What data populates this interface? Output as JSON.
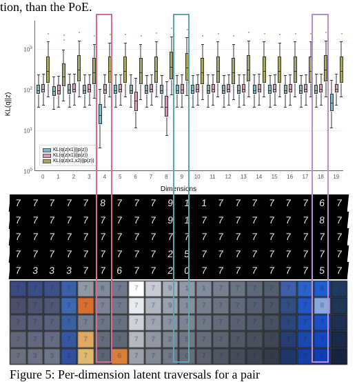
{
  "top_fragment": "tion, than the PoE.",
  "caption_fragment": "Figure 5: Per-dimension latent traversals for a pair",
  "highlights": [
    {
      "dim": 4,
      "color": "#d36e8a"
    },
    {
      "dim": 9,
      "color": "#5aa6b3"
    },
    {
      "dim": 18,
      "color": "#b48fd6"
    }
  ],
  "chart_data": {
    "type": "box",
    "title": "",
    "xlabel": "Dimensions",
    "ylabel": "KL(q||z)",
    "yscale": "log",
    "ylim": [
      1,
      5000
    ],
    "yticks": [
      1,
      10,
      100,
      1000
    ],
    "categories": [
      0,
      1,
      2,
      3,
      4,
      5,
      6,
      7,
      8,
      9,
      10,
      11,
      12,
      13,
      14,
      15,
      16,
      17,
      18,
      19
    ],
    "series": [
      {
        "name": "KL(q(z|x1)||p(z))",
        "color": "#7eb6c4"
      },
      {
        "name": "KL(q(z|x1)||p(z))",
        "color": "#d89ab4"
      },
      {
        "name": "KL(q(z|x1,x2)||p(z))",
        "color": "#a9a75a"
      }
    ],
    "data": {
      "0": {
        "s0": {
          "q1": 80,
          "med": 100,
          "q3": 130,
          "lo": 40,
          "hi": 250,
          "out": []
        },
        "s1": {
          "q1": 85,
          "med": 110,
          "q3": 140,
          "lo": 45,
          "hi": 260,
          "out": []
        },
        "s2": {
          "q1": 150,
          "med": 300,
          "q3": 650,
          "lo": 70,
          "hi": 1600,
          "out": [
            2400
          ]
        }
      },
      "1": {
        "s0": {
          "q1": 70,
          "med": 95,
          "q3": 120,
          "lo": 35,
          "hi": 220,
          "out": []
        },
        "s1": {
          "q1": 75,
          "med": 100,
          "q3": 130,
          "lo": 40,
          "hi": 230,
          "out": []
        },
        "s2": {
          "q1": 120,
          "med": 220,
          "q3": 450,
          "lo": 55,
          "hi": 1000,
          "out": [
            1700,
            2200
          ]
        }
      },
      "2": {
        "s0": {
          "q1": 80,
          "med": 105,
          "q3": 135,
          "lo": 40,
          "hi": 260,
          "out": []
        },
        "s1": {
          "q1": 85,
          "med": 110,
          "q3": 145,
          "lo": 45,
          "hi": 260,
          "out": []
        },
        "s2": {
          "q1": 160,
          "med": 320,
          "q3": 700,
          "lo": 70,
          "hi": 1700,
          "out": [
            2600
          ]
        }
      },
      "3": {
        "s0": {
          "q1": 80,
          "med": 100,
          "q3": 130,
          "lo": 40,
          "hi": 250,
          "out": []
        },
        "s1": {
          "q1": 85,
          "med": 110,
          "q3": 140,
          "lo": 45,
          "hi": 250,
          "out": []
        },
        "s2": {
          "q1": 140,
          "med": 280,
          "q3": 600,
          "lo": 65,
          "hi": 1400,
          "out": [
            2100
          ]
        }
      },
      "4": {
        "s0": {
          "q1": 14,
          "med": 25,
          "q3": 45,
          "lo": 4,
          "hi": 110,
          "out": []
        },
        "s1": {
          "q1": 80,
          "med": 105,
          "q3": 135,
          "lo": 40,
          "hi": 250,
          "out": []
        },
        "s2": {
          "q1": 150,
          "med": 300,
          "q3": 650,
          "lo": 70,
          "hi": 1500,
          "out": [
            2300
          ]
        }
      },
      "5": {
        "s0": {
          "q1": 80,
          "med": 100,
          "q3": 130,
          "lo": 40,
          "hi": 250,
          "out": []
        },
        "s1": {
          "q1": 85,
          "med": 110,
          "q3": 140,
          "lo": 45,
          "hi": 250,
          "out": []
        },
        "s2": {
          "q1": 150,
          "med": 300,
          "q3": 650,
          "lo": 70,
          "hi": 1500,
          "out": [
            2300
          ]
        }
      },
      "6": {
        "s0": {
          "q1": 80,
          "med": 100,
          "q3": 130,
          "lo": 40,
          "hi": 250,
          "out": []
        },
        "s1": {
          "q1": 30,
          "med": 55,
          "q3": 90,
          "lo": 12,
          "hi": 200,
          "out": []
        },
        "s2": {
          "q1": 140,
          "med": 280,
          "q3": 600,
          "lo": 60,
          "hi": 1400,
          "out": [
            2100
          ]
        }
      },
      "7": {
        "s0": {
          "q1": 80,
          "med": 100,
          "q3": 130,
          "lo": 40,
          "hi": 240,
          "out": []
        },
        "s1": {
          "q1": 85,
          "med": 110,
          "q3": 140,
          "lo": 45,
          "hi": 250,
          "out": []
        },
        "s2": {
          "q1": 150,
          "med": 300,
          "q3": 650,
          "lo": 70,
          "hi": 1600,
          "out": [
            2500
          ]
        }
      },
      "8": {
        "s0": {
          "q1": 80,
          "med": 100,
          "q3": 130,
          "lo": 40,
          "hi": 240,
          "out": []
        },
        "s1": {
          "q1": 22,
          "med": 40,
          "q3": 70,
          "lo": 8,
          "hi": 170,
          "out": []
        },
        "s2": {
          "q1": 180,
          "med": 380,
          "q3": 850,
          "lo": 80,
          "hi": 2100,
          "out": [
            3200
          ]
        }
      },
      "9": {
        "s0": {
          "q1": 80,
          "med": 100,
          "q3": 130,
          "lo": 40,
          "hi": 240,
          "out": []
        },
        "s1": {
          "q1": 80,
          "med": 105,
          "q3": 135,
          "lo": 40,
          "hi": 250,
          "out": []
        },
        "s2": {
          "q1": 170,
          "med": 360,
          "q3": 800,
          "lo": 75,
          "hi": 2000,
          "out": [
            3000
          ]
        }
      },
      "10": {
        "s0": {
          "q1": 80,
          "med": 100,
          "q3": 130,
          "lo": 40,
          "hi": 240,
          "out": []
        },
        "s1": {
          "q1": 85,
          "med": 110,
          "q3": 140,
          "lo": 45,
          "hi": 250,
          "out": []
        },
        "s2": {
          "q1": 140,
          "med": 280,
          "q3": 600,
          "lo": 60,
          "hi": 1400,
          "out": [
            2100
          ]
        }
      },
      "11": {
        "s0": {
          "q1": 80,
          "med": 100,
          "q3": 130,
          "lo": 40,
          "hi": 250,
          "out": []
        },
        "s1": {
          "q1": 85,
          "med": 110,
          "q3": 140,
          "lo": 45,
          "hi": 250,
          "out": []
        },
        "s2": {
          "q1": 150,
          "med": 300,
          "q3": 650,
          "lo": 70,
          "hi": 1600,
          "out": [
            2400
          ]
        }
      },
      "12": {
        "s0": {
          "q1": 80,
          "med": 100,
          "q3": 130,
          "lo": 40,
          "hi": 240,
          "out": []
        },
        "s1": {
          "q1": 85,
          "med": 110,
          "q3": 140,
          "lo": 45,
          "hi": 250,
          "out": []
        },
        "s2": {
          "q1": 140,
          "med": 280,
          "q3": 600,
          "lo": 60,
          "hi": 1400,
          "out": [
            2100
          ]
        }
      },
      "13": {
        "s0": {
          "q1": 80,
          "med": 100,
          "q3": 130,
          "lo": 40,
          "hi": 250,
          "out": []
        },
        "s1": {
          "q1": 85,
          "med": 110,
          "q3": 140,
          "lo": 45,
          "hi": 250,
          "out": []
        },
        "s2": {
          "q1": 160,
          "med": 320,
          "q3": 700,
          "lo": 70,
          "hi": 1700,
          "out": [
            2600
          ]
        }
      },
      "14": {
        "s0": {
          "q1": 80,
          "med": 100,
          "q3": 130,
          "lo": 40,
          "hi": 250,
          "out": []
        },
        "s1": {
          "q1": 85,
          "med": 110,
          "q3": 140,
          "lo": 45,
          "hi": 260,
          "out": []
        },
        "s2": {
          "q1": 150,
          "med": 300,
          "q3": 650,
          "lo": 70,
          "hi": 1600,
          "out": [
            2400
          ]
        }
      },
      "15": {
        "s0": {
          "q1": 80,
          "med": 100,
          "q3": 130,
          "lo": 40,
          "hi": 240,
          "out": []
        },
        "s1": {
          "q1": 85,
          "med": 110,
          "q3": 140,
          "lo": 45,
          "hi": 250,
          "out": []
        },
        "s2": {
          "q1": 150,
          "med": 300,
          "q3": 650,
          "lo": 70,
          "hi": 1500,
          "out": [
            2300
          ]
        }
      },
      "16": {
        "s0": {
          "q1": 80,
          "med": 100,
          "q3": 130,
          "lo": 40,
          "hi": 240,
          "out": []
        },
        "s1": {
          "q1": 85,
          "med": 110,
          "q3": 140,
          "lo": 45,
          "hi": 250,
          "out": []
        },
        "s2": {
          "q1": 150,
          "med": 300,
          "q3": 650,
          "lo": 70,
          "hi": 1600,
          "out": [
            2400
          ]
        }
      },
      "17": {
        "s0": {
          "q1": 80,
          "med": 100,
          "q3": 130,
          "lo": 40,
          "hi": 240,
          "out": []
        },
        "s1": {
          "q1": 85,
          "med": 110,
          "q3": 140,
          "lo": 45,
          "hi": 250,
          "out": []
        },
        "s2": {
          "q1": 150,
          "med": 300,
          "q3": 650,
          "lo": 70,
          "hi": 1600,
          "out": [
            2400
          ]
        }
      },
      "18": {
        "s0": {
          "q1": 80,
          "med": 100,
          "q3": 130,
          "lo": 40,
          "hi": 260,
          "out": []
        },
        "s1": {
          "q1": 85,
          "med": 110,
          "q3": 140,
          "lo": 45,
          "hi": 260,
          "out": []
        },
        "s2": {
          "q1": 160,
          "med": 320,
          "q3": 700,
          "lo": 70,
          "hi": 1700,
          "out": [
            2600
          ]
        }
      },
      "19": {
        "s0": {
          "q1": 30,
          "med": 50,
          "q3": 80,
          "lo": 12,
          "hi": 180,
          "out": []
        },
        "s1": {
          "q1": 85,
          "med": 110,
          "q3": 140,
          "lo": 45,
          "hi": 260,
          "out": []
        },
        "s2": {
          "q1": 150,
          "med": 300,
          "q3": 650,
          "lo": 70,
          "hi": 1600,
          "out": [
            2400
          ]
        }
      }
    }
  },
  "mnist_grid": [
    [
      "7",
      "7",
      "7",
      "7",
      "7",
      "8",
      "7",
      "7",
      "7",
      "9",
      "1",
      "1",
      "7",
      "7",
      "7",
      "7",
      "7",
      "7",
      "6",
      "7"
    ],
    [
      "7",
      "7",
      "7",
      "7",
      "7",
      "7",
      "7",
      "7",
      "7",
      "9",
      "1",
      "7",
      "7",
      "7",
      "7",
      "7",
      "7",
      "7",
      "8",
      "7"
    ],
    [
      "7",
      "7",
      "7",
      "7",
      "7",
      "7",
      "7",
      "7",
      "7",
      "7",
      "7",
      "7",
      "7",
      "7",
      "7",
      "7",
      "7",
      "7",
      "7",
      "7"
    ],
    [
      "7",
      "7",
      "7",
      "7",
      "7",
      "7",
      "7",
      "7",
      "7",
      "2",
      "5",
      "7",
      "7",
      "7",
      "7",
      "7",
      "7",
      "7",
      "7",
      "7"
    ],
    [
      "7",
      "3",
      "3",
      "3",
      "7",
      "7",
      "6",
      "7",
      "7",
      "2",
      "0",
      "7",
      "7",
      "7",
      "7",
      "7",
      "7",
      "7",
      "5",
      "7"
    ]
  ],
  "svhn_grid_colors": [
    [
      "#3a4a80",
      "#3b4d85",
      "#3d508a",
      "#3b5fa8",
      "#9098a2",
      "#808a98",
      "#70788a",
      "#ffffff",
      "#c8ccd4",
      "#a8aeba",
      "#9298a6",
      "#848c9c",
      "#78808e",
      "#6c7482",
      "#5f6878",
      "#545d6e",
      "#3f5fa8",
      "#2a63c8",
      "#1f5ed0",
      "#203a60"
    ],
    [
      "#4a506a",
      "#4c5470",
      "#4e5876",
      "#3e68b0",
      "#d86e30",
      "#7c8494",
      "#70788a",
      "#e8eaee",
      "#b0b6c2",
      "#9aa0ae",
      "#888e9c",
      "#78808e",
      "#6c7482",
      "#606a7c",
      "#566072",
      "#4c5668",
      "#314e80",
      "#2256c0",
      "#8aa8e0",
      "#1e3658"
    ],
    [
      "#555b72",
      "#565e78",
      "#58627e",
      "#3a60a0",
      "#788090",
      "#6c7484",
      "#687080",
      "#cdd1d8",
      "#9ea4b0",
      "#8c92a0",
      "#7c8492",
      "#707886",
      "#646c7c",
      "#5a6272",
      "#505a6a",
      "#465060",
      "#2b4678",
      "#1e4eb8",
      "#1a50c8",
      "#1e3050"
    ],
    [
      "#606678",
      "#62687e",
      "#646c84",
      "#3658a0",
      "#e0a860",
      "#646c7c",
      "#606878",
      "#b4b8c0",
      "#9096a2",
      "#808694",
      "#727886",
      "#666c7a",
      "#5c6270",
      "#525866",
      "#48505e",
      "#3e4656",
      "#263e70",
      "#1948b0",
      "#1448c0",
      "#1a2a48"
    ],
    [
      "#6a707e",
      "#6c7284",
      "#6e768a",
      "#3250a0",
      "#e0b870",
      "#5c6474",
      "#d88038",
      "#9ca0a8",
      "#828894",
      "#727886",
      "#666c7a",
      "#5a606e",
      "#505664",
      "#464c5a",
      "#3e4452",
      "#343c4a",
      "#213668",
      "#1540a8",
      "#103eb8",
      "#162440"
    ]
  ]
}
